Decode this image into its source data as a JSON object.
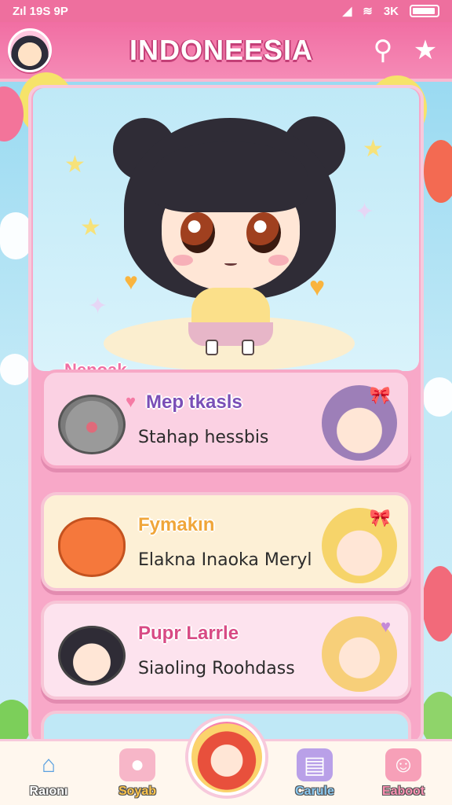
{
  "status_bar": {
    "left": "Zıl 19S 9P",
    "right": "3K"
  },
  "header": {
    "title": "INDONEESIA",
    "icons": [
      "avatar",
      "search-icon",
      "star-icon"
    ]
  },
  "stage": {
    "label": "Nenoak"
  },
  "cards": [
    {
      "title": "Mep tkasls",
      "subtitle": "Stahap hessbis",
      "thumb": "grey-cat",
      "character": "purple-hair-girl"
    },
    {
      "title": "Fymakın",
      "subtitle": "Elakna Inaoka Meryl",
      "thumb": "orange-fox",
      "character": "blonde-girl"
    },
    {
      "title": "Pupr Larrle",
      "subtitle": "Siaoling Roohdass",
      "thumb": "cat-boy",
      "character": "long-blonde-girl"
    }
  ],
  "bottom_nav": {
    "items": [
      {
        "label": "Raıonı",
        "icon": "home-icon"
      },
      {
        "label": "Soyab",
        "icon": "pig-icon"
      },
      {
        "label": "Carule",
        "icon": "case-icon"
      },
      {
        "label": "Eaboot",
        "icon": "smile-icon"
      }
    ],
    "center_icon": "character-avatar-icon"
  },
  "colors": {
    "primary": "#f16ea3",
    "panel": "#f8a8c8",
    "sky": "#8fd6f0",
    "gold": "#f9b43e"
  }
}
